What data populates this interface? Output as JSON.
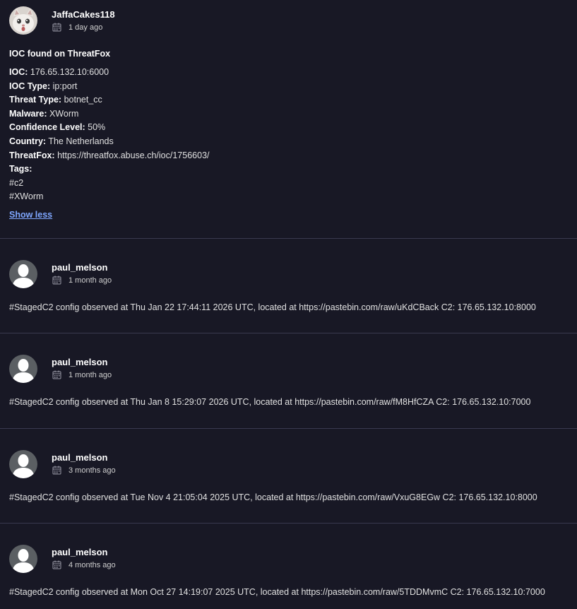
{
  "comments": [
    {
      "user": "JaffaCakes118",
      "time": "1 day ago",
      "title": "IOC found on ThreatFox",
      "fields": [
        {
          "label": "IOC:",
          "value": " 176.65.132.10:6000"
        },
        {
          "label": "IOC Type:",
          "value": " ip:port"
        },
        {
          "label": "Threat Type:",
          "value": " botnet_cc"
        },
        {
          "label": "Malware:",
          "value": " XWorm"
        },
        {
          "label": "Confidence Level:",
          "value": " 50%"
        },
        {
          "label": "Country:",
          "value": " The Netherlands"
        },
        {
          "label": "ThreatFox:",
          "value": " https://threatfox.abuse.ch/ioc/1756603/"
        },
        {
          "label": "Tags:",
          "value": ""
        }
      ],
      "tags": [
        "#c2",
        "#XWorm"
      ],
      "show_less": "Show less"
    },
    {
      "user": "paul_melson",
      "time": "1 month ago",
      "text": "#StagedC2 config observed at Thu Jan 22 17:44:11 2026 UTC, located at https://pastebin.com/raw/uKdCBack C2: 176.65.132.10:8000"
    },
    {
      "user": "paul_melson",
      "time": "1 month ago",
      "text": "#StagedC2 config observed at Thu Jan 8 15:29:07 2026 UTC, located at https://pastebin.com/raw/fM8HfCZA C2: 176.65.132.10:7000"
    },
    {
      "user": "paul_melson",
      "time": "3 months ago",
      "text": "#StagedC2 config observed at Tue Nov 4 21:05:04 2025 UTC, located at https://pastebin.com/raw/VxuG8EGw C2: 176.65.132.10:8000"
    },
    {
      "user": "paul_melson",
      "time": "4 months ago",
      "text": "#StagedC2 config observed at Mon Oct 27 14:19:07 2025 UTC, located at https://pastebin.com/raw/5TDDMvmC C2: 176.65.132.10:7000"
    }
  ],
  "icons": {
    "calendar": "calendar-icon",
    "cat_avatar": "cat-avatar",
    "default_avatar": "default-user-avatar"
  },
  "colors": {
    "background": "#181825",
    "divider": "#3a3a50",
    "link": "#7fa7ff"
  }
}
